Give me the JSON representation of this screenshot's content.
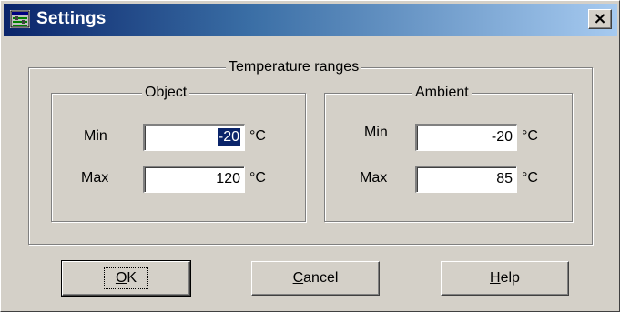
{
  "window": {
    "title": "Settings",
    "close_glyph": "×",
    "title_bar_color": "#0a246a",
    "icon": "settings-app-icon"
  },
  "temperature_group": {
    "label": "Temperature ranges",
    "object": {
      "label": "Object",
      "min_label": "Min",
      "min_value": "-20",
      "max_label": "Max",
      "max_value": "120",
      "unit": "°C"
    },
    "ambient": {
      "label": "Ambient",
      "min_label": "Min",
      "min_value": "-20",
      "max_label": "Max",
      "max_value": "85",
      "unit": "°C"
    }
  },
  "buttons": {
    "ok": {
      "mnemonic": "O",
      "rest": "K"
    },
    "cancel": {
      "mnemonic": "C",
      "rest": "ancel"
    },
    "help": {
      "mnemonic": "H",
      "rest": "elp"
    }
  }
}
